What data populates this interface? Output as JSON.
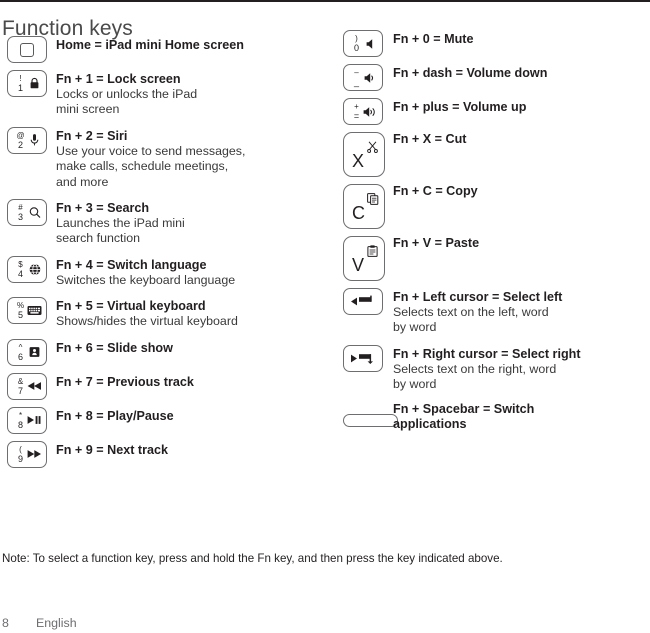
{
  "page": {
    "title": "Function keys",
    "note": "Note: To select a function key, press and hold the Fn key, and then press the key indicated above.",
    "folio_number": "8",
    "folio_language": "English"
  },
  "left_column": [
    {
      "key": {
        "type": "home",
        "icon": "home-square-icon"
      },
      "title": "Home = iPad mini Home screen",
      "desc": ""
    },
    {
      "key": {
        "type": "number",
        "shift": "!",
        "base": "1",
        "icon": "lock-icon"
      },
      "title": "Fn + 1 = Lock screen",
      "desc": "Locks or unlocks the iPad\nmini screen"
    },
    {
      "key": {
        "type": "number",
        "shift": "@",
        "base": "2",
        "icon": "microphone-icon"
      },
      "title": "Fn + 2 = Siri",
      "desc": "Use your voice to send messages,\nmake calls, schedule meetings,\nand more"
    },
    {
      "key": {
        "type": "number",
        "shift": "#",
        "base": "3",
        "icon": "search-icon"
      },
      "title": "Fn + 3 = Search",
      "desc": "Launches the iPad mini\nsearch function"
    },
    {
      "key": {
        "type": "number",
        "shift": "$",
        "base": "4",
        "icon": "globe-icon"
      },
      "title": "Fn + 4 = Switch language",
      "desc": "Switches the keyboard language"
    },
    {
      "key": {
        "type": "number",
        "shift": "%",
        "base": "5",
        "icon": "keyboard-icon"
      },
      "title": "Fn + 5 = Virtual keyboard",
      "desc": "Shows/hides the virtual keyboard"
    },
    {
      "key": {
        "type": "number",
        "shift": "^",
        "base": "6",
        "icon": "slideshow-icon"
      },
      "title": "Fn + 6 = Slide show",
      "desc": ""
    },
    {
      "key": {
        "type": "number",
        "shift": "&",
        "base": "7",
        "icon": "previous-track-icon"
      },
      "title": "Fn + 7 = Previous track",
      "desc": ""
    },
    {
      "key": {
        "type": "number",
        "shift": "*",
        "base": "8",
        "icon": "play-pause-icon"
      },
      "title": "Fn + 8 = Play/Pause",
      "desc": ""
    },
    {
      "key": {
        "type": "number",
        "shift": "(",
        "base": "9",
        "icon": "next-track-icon"
      },
      "title": "Fn + 9 = Next track",
      "desc": ""
    }
  ],
  "right_column": [
    {
      "key": {
        "type": "number",
        "shift": ")",
        "base": "0",
        "icon": "mute-icon"
      },
      "title": "Fn + 0 = Mute",
      "desc": ""
    },
    {
      "key": {
        "type": "number",
        "shift": "–",
        "base": "_",
        "icon": "volume-down-icon"
      },
      "title": "Fn + dash = Volume down",
      "desc": ""
    },
    {
      "key": {
        "type": "number",
        "shift": "+",
        "base": "=",
        "icon": "volume-up-icon"
      },
      "title": "Fn + plus = Volume up",
      "desc": ""
    },
    {
      "key": {
        "type": "letter",
        "letter": "X",
        "icon": "scissors-icon"
      },
      "title": "Fn + X = Cut",
      "desc": ""
    },
    {
      "key": {
        "type": "letter",
        "letter": "C",
        "icon": "copy-icon"
      },
      "title": "Fn + C = Copy",
      "desc": ""
    },
    {
      "key": {
        "type": "letter",
        "letter": "V",
        "icon": "paste-icon"
      },
      "title": "Fn + V = Paste",
      "desc": ""
    },
    {
      "key": {
        "type": "cursor",
        "icon": "select-left-icon"
      },
      "title": "Fn + Left cursor = Select left",
      "desc": "Selects text on the left, word\nby word"
    },
    {
      "key": {
        "type": "cursor",
        "icon": "select-right-icon"
      },
      "title": "Fn + Right cursor = Select right",
      "desc": "Selects text on the right, word\nby word"
    },
    {
      "key": {
        "type": "space",
        "icon": "spacebar-icon"
      },
      "title": "Fn + Spacebar = Switch\napplications",
      "desc": ""
    }
  ],
  "colors": {
    "text": "#231f20",
    "key_outline": "#6d6e71",
    "title_gray": "#4a4a4a",
    "folio_gray": "#6d6e71"
  }
}
